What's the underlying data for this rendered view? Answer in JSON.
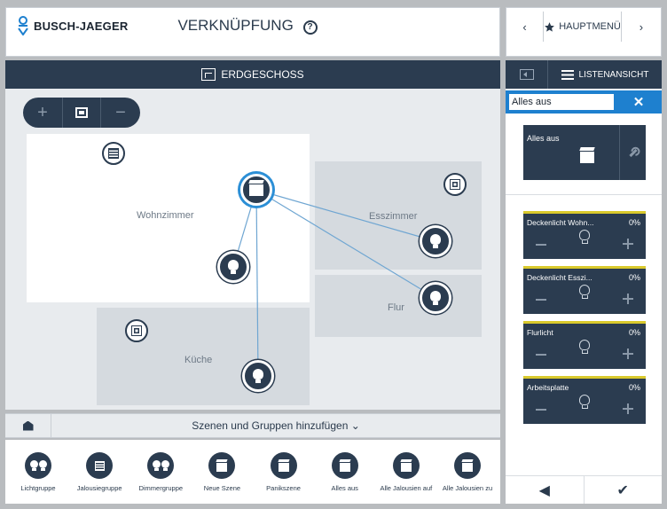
{
  "header": {
    "logo_text": "BUSCH-JAEGER",
    "title": "VERKNÜPFUNG",
    "help_icon": "?"
  },
  "nav": {
    "prev_label": "‹",
    "home_label": "HAUPTMENÜ",
    "next_label": "›"
  },
  "floorplan": {
    "floor_name": "ERDGESCHOSS",
    "zoom_in": "+",
    "zoom_out": "−",
    "rooms": {
      "wohnzimmer": "Wohnzimmer",
      "esszimmer": "Esszimmer",
      "flur": "Flur",
      "kueche": "Küche"
    }
  },
  "add_bar": {
    "label": "Szenen und Gruppen hinzufügen ⌄"
  },
  "palette": [
    {
      "label": "Lichtgruppe",
      "icon": "double-bulb-icon"
    },
    {
      "label": "Jalousiegruppe",
      "icon": "blind-icon"
    },
    {
      "label": "Dimmergruppe",
      "icon": "double-bulb-icon"
    },
    {
      "label": "Neue Szene",
      "icon": "scene-icon"
    },
    {
      "label": "Panikszene",
      "icon": "scene-icon"
    },
    {
      "label": "Alles aus",
      "icon": "scene-icon"
    },
    {
      "label": "Alle Jalousien auf",
      "icon": "scene-icon"
    },
    {
      "label": "Alle Jalousien zu",
      "icon": "scene-icon"
    }
  ],
  "right_panel": {
    "listview_label": "LISTENANSICHT",
    "name_value": "Alles aus",
    "close_label": "✕",
    "scene_card_title": "Alles aus",
    "devices": [
      {
        "name": "Deckenlicht Wohn...",
        "percent": "0%"
      },
      {
        "name": "Deckenlicht Esszi...",
        "percent": "0%"
      },
      {
        "name": "Flurlicht",
        "percent": "0%"
      },
      {
        "name": "Arbeitsplatte",
        "percent": "0%"
      }
    ],
    "back_label": "◀",
    "confirm_label": "✔"
  },
  "colors": {
    "primary_dark": "#2b3c50",
    "accent_blue": "#1e80cf",
    "device_status": "#d9c92c"
  }
}
